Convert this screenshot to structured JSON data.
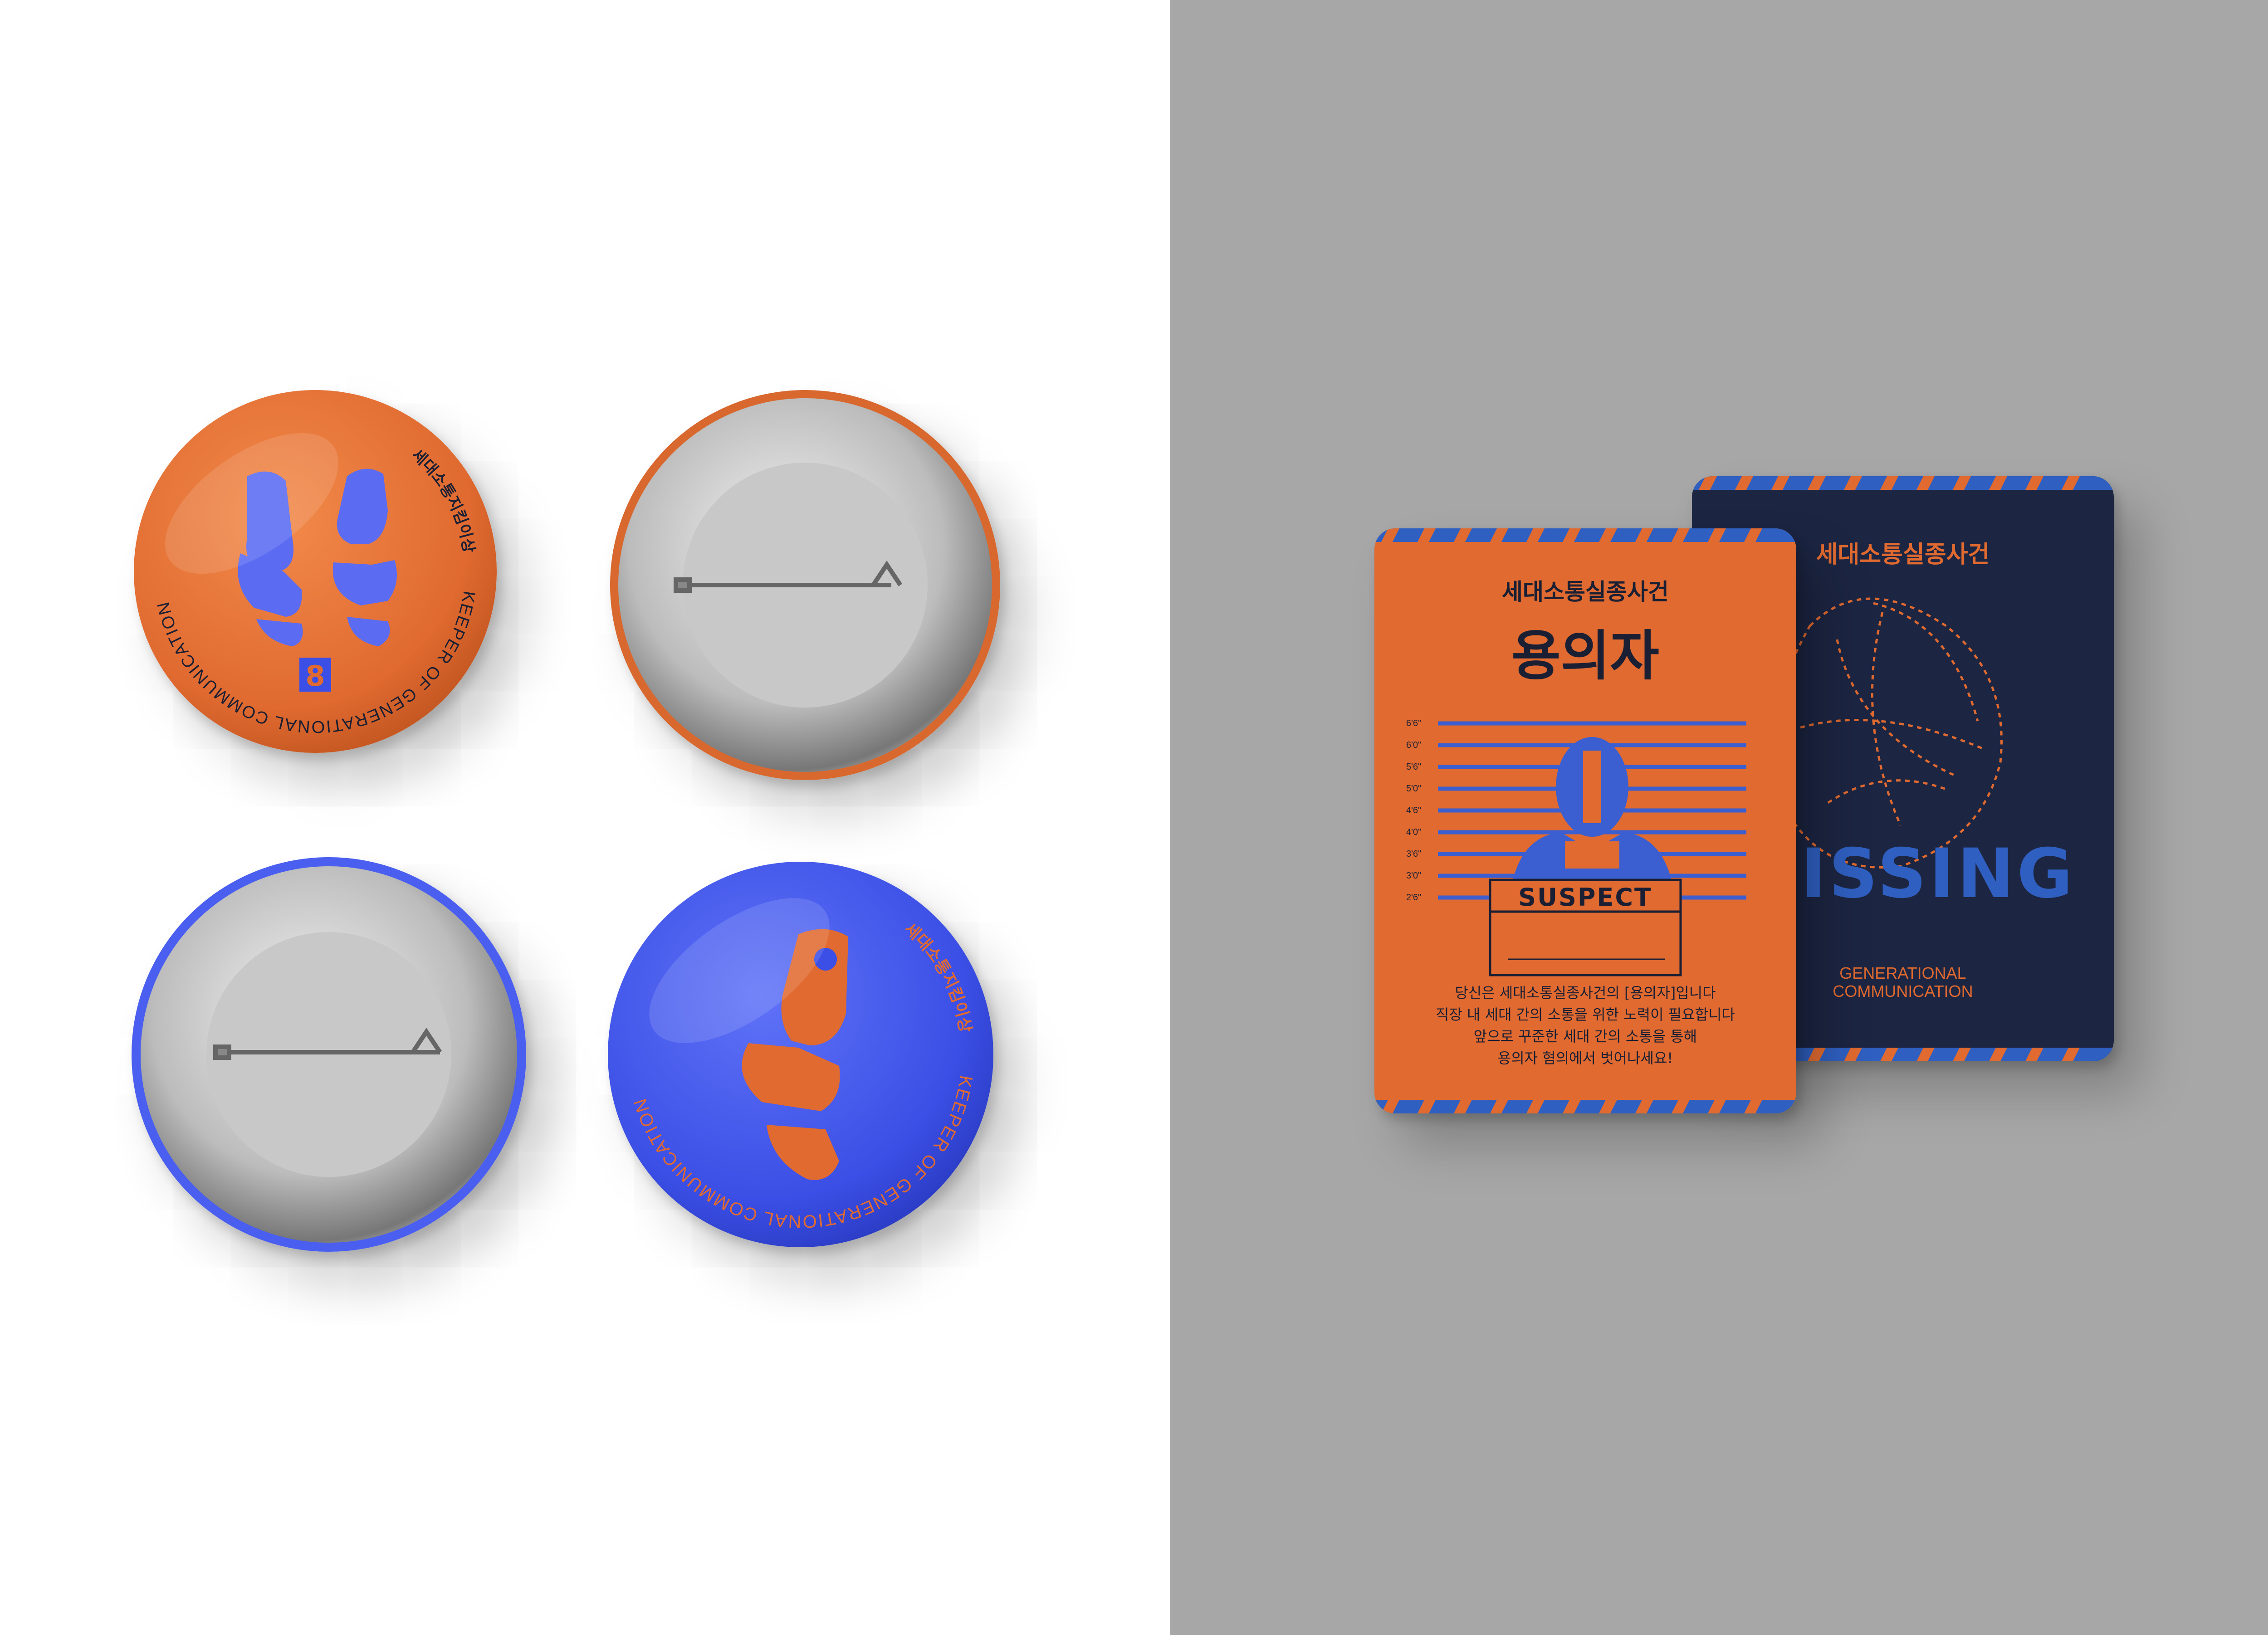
{
  "colors": {
    "orange": "#e06a30",
    "blue": "#4a5ff0",
    "royal": "#3b4fe6",
    "navy": "#1c2542",
    "ink": "#1a1f33",
    "card_blue": "#2f5fc0",
    "bg_gray": "#a7a7a7"
  },
  "badges": {
    "orange_front": {
      "ring_text_en": "KEEPER OF GENERATIONAL COMMUNICATION",
      "ring_text_ko": "세대소통지킴이상",
      "emblem_glyph": "8",
      "icon": "feet-icon"
    },
    "orange_back": {
      "icon": "pin-clasp-icon"
    },
    "blue_back": {
      "icon": "pin-clasp-icon"
    },
    "blue_front": {
      "ring_text_en": "KEEPER OF GENERATIONAL COMMUNICATION",
      "ring_text_ko": "세대소통지킴이상",
      "icon": "foot-icon"
    }
  },
  "cards": {
    "suspect": {
      "kicker": "세대소통실종사건",
      "title": "용의자",
      "height_marks": [
        "6'6\"",
        "6'0\"",
        "5'6\"",
        "5'0\"",
        "4'6\"",
        "4'0\"",
        "3'6\"",
        "3'0\"",
        "2'6\""
      ],
      "sign_label": "SUSPECT",
      "body_lines": [
        "당신은 세대소통실종사건의 [용의자]입니다",
        "직장 내 세대 간의 소통을 위한 노력이 필요합니다",
        "앞으로 꾸준한 세대 간의 소통을 통해",
        "용의자 혐의에서 벗어나세요!"
      ]
    },
    "missing": {
      "kicker": "세대소통실종사건",
      "stamp": "MISSING",
      "footer_line1": "GENERATIONAL",
      "footer_line2": "COMMUNICATION"
    }
  }
}
